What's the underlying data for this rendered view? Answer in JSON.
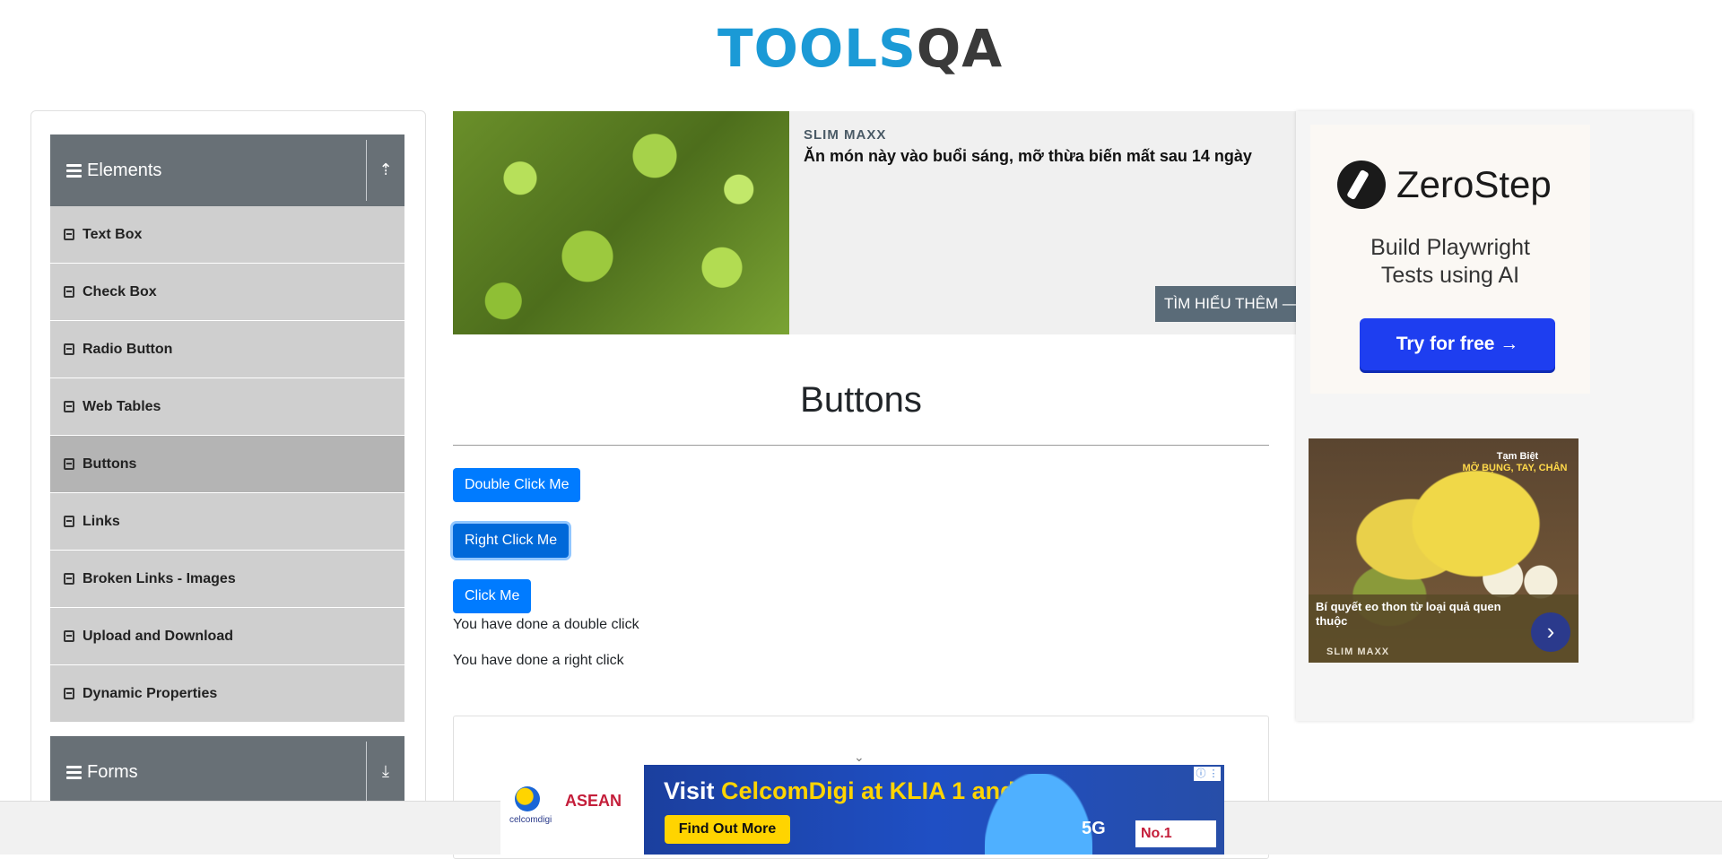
{
  "header": {
    "logo_tools": "TOOLS",
    "logo_qa": "QA"
  },
  "sidebar": {
    "elements_group": {
      "title": "Elements",
      "toggle_icon": "collapse-up-icon"
    },
    "items": [
      {
        "label": "Text Box"
      },
      {
        "label": "Check Box"
      },
      {
        "label": "Radio Button"
      },
      {
        "label": "Web Tables"
      },
      {
        "label": "Buttons",
        "active": true
      },
      {
        "label": "Links"
      },
      {
        "label": "Broken Links - Images"
      },
      {
        "label": "Upload and Download"
      },
      {
        "label": "Dynamic Properties"
      }
    ],
    "forms_group": {
      "title": "Forms",
      "toggle_icon": "expand-down-icon"
    }
  },
  "top_ad": {
    "brand": "SLIM MAXX",
    "headline": "Ăn món này vào buổi sáng, mỡ thừa biến mất sau 14 ngày",
    "cta": "TÌM HIỂU THÊM —"
  },
  "main": {
    "title": "Buttons",
    "buttons": {
      "double_click": "Double Click Me",
      "right_click": "Right Click Me",
      "click": "Click Me"
    },
    "messages": {
      "double_click": "You have done a double click",
      "right_click": "You have done a right click"
    }
  },
  "right_ad": {
    "zerostep": {
      "name": "ZeroStep",
      "tagline_line1": "Build Playwright",
      "tagline_line2": "Tests using AI",
      "cta": "Try for free →"
    },
    "banana": {
      "tag_line1": "Tạm Biệt",
      "tag_line2": "MỠ BỤNG, TAY, CHÂN",
      "caption": "Bí quyết eo thon từ loại quả quen thuộc",
      "brand": "SLIM MAXX"
    }
  },
  "bottom_ad": {
    "celcom_name": "celcomdigi",
    "asean": "ASEAN",
    "visit_prefix": "Visit ",
    "visit_highlight": "CelcomDigi at KLIA 1 and 2",
    "cta": "Find Out More",
    "five_g": "5G",
    "no1": "No.1"
  },
  "colors": {
    "primary_button": "#007bff",
    "sidebar_header": "#687076",
    "sidebar_item": "#cfcfcf",
    "logo_blue": "#1b9ad6"
  }
}
